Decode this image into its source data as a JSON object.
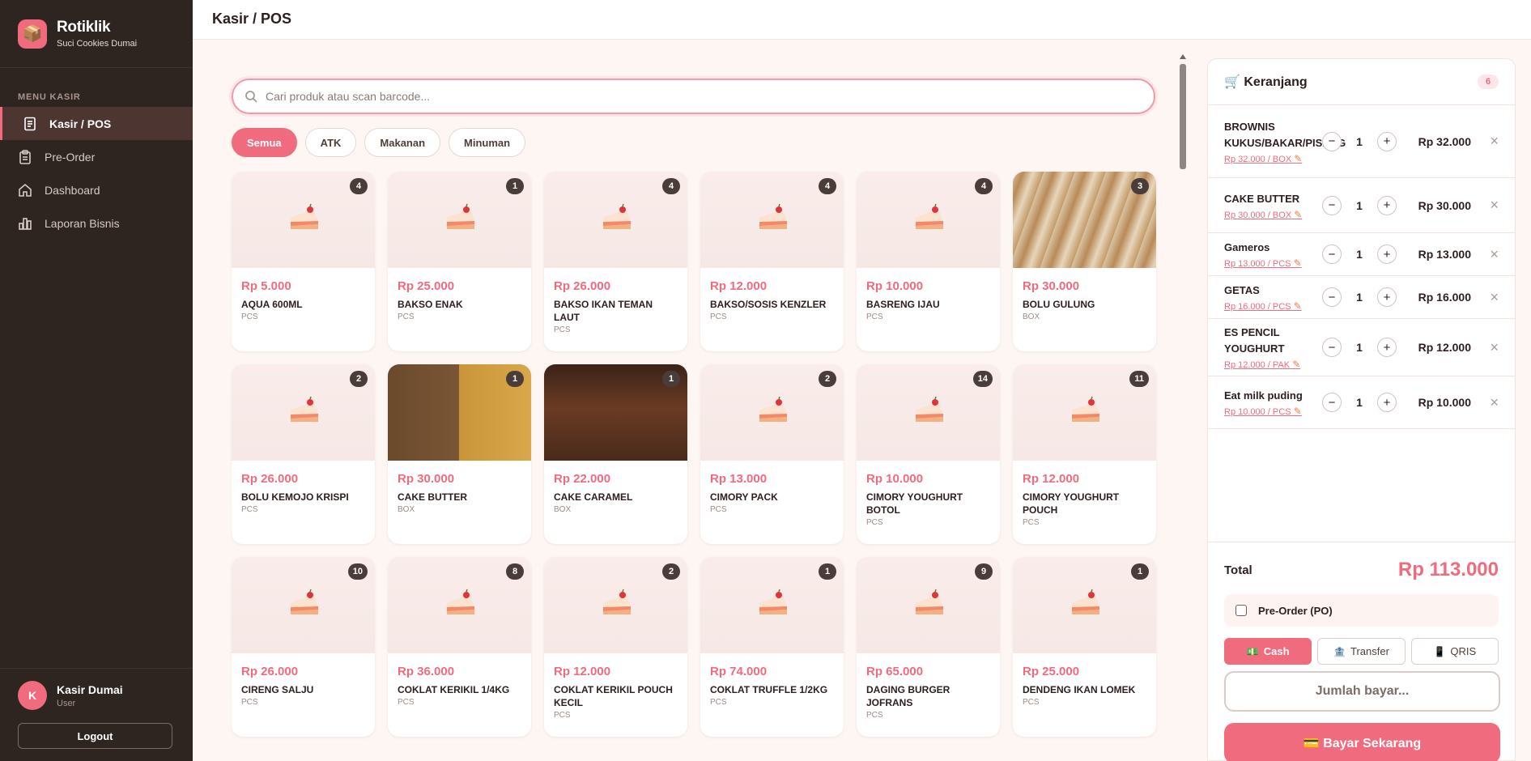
{
  "brand": {
    "name": "Rotiklik",
    "store": "Suci Cookies Dumai"
  },
  "sidebar": {
    "section_label": "MENU KASIR",
    "items": [
      {
        "label": "Kasir / POS",
        "icon": "receipt-icon",
        "active": true
      },
      {
        "label": "Pre-Order",
        "icon": "clipboard-icon",
        "active": false
      },
      {
        "label": "Dashboard",
        "icon": "home-icon",
        "active": false
      },
      {
        "label": "Laporan Bisnis",
        "icon": "bar-chart-icon",
        "active": false
      }
    ],
    "user": {
      "initial": "K",
      "name": "Kasir Dumai",
      "role": "User"
    },
    "logout_label": "Logout"
  },
  "header": {
    "title": "Kasir / POS"
  },
  "search": {
    "placeholder": "Cari produk atau scan barcode..."
  },
  "filters": [
    "Semua",
    "ATK",
    "Makanan",
    "Minuman"
  ],
  "active_filter": "Semua",
  "products": [
    {
      "price": "Rp 5.000",
      "name": "AQUA 600ML",
      "unit": "PCS",
      "stock": "4",
      "image": "cake"
    },
    {
      "price": "Rp 25.000",
      "name": "BAKSO ENAK",
      "unit": "PCS",
      "stock": "1",
      "image": "cake"
    },
    {
      "price": "Rp 26.000",
      "name": "BAKSO IKAN TEMAN LAUT",
      "unit": "PCS",
      "stock": "4",
      "image": "cake"
    },
    {
      "price": "Rp 12.000",
      "name": "BAKSO/SOSIS KENZLER",
      "unit": "PCS",
      "stock": "4",
      "image": "cake"
    },
    {
      "price": "Rp 10.000",
      "name": "BASRENG IJAU",
      "unit": "PCS",
      "stock": "4",
      "image": "cake"
    },
    {
      "price": "Rp 30.000",
      "name": "BOLU GULUNG",
      "unit": "BOX",
      "stock": "3",
      "image": "photo-roll"
    },
    {
      "price": "Rp 26.000",
      "name": "BOLU KEMOJO KRISPI",
      "unit": "PCS",
      "stock": "2",
      "image": "cake"
    },
    {
      "price": "Rp 30.000",
      "name": "CAKE BUTTER",
      "unit": "BOX",
      "stock": "1",
      "image": "photo-butter"
    },
    {
      "price": "Rp 22.000",
      "name": "CAKE CARAMEL",
      "unit": "BOX",
      "stock": "1",
      "image": "photo-caramel"
    },
    {
      "price": "Rp 13.000",
      "name": "CIMORY PACK",
      "unit": "PCS",
      "stock": "2",
      "image": "cake"
    },
    {
      "price": "Rp 10.000",
      "name": "CIMORY YOUGHURT BOTOL",
      "unit": "PCS",
      "stock": "14",
      "image": "cake"
    },
    {
      "price": "Rp 12.000",
      "name": "CIMORY YOUGHURT POUCH",
      "unit": "PCS",
      "stock": "11",
      "image": "cake"
    },
    {
      "price": "Rp 26.000",
      "name": "CIRENG SALJU",
      "unit": "PCS",
      "stock": "10",
      "image": "cake"
    },
    {
      "price": "Rp 36.000",
      "name": "COKLAT KERIKIL 1/4KG",
      "unit": "PCS",
      "stock": "8",
      "image": "cake"
    },
    {
      "price": "Rp 12.000",
      "name": "COKLAT KERIKIL POUCH KECIL",
      "unit": "PCS",
      "stock": "2",
      "image": "cake"
    },
    {
      "price": "Rp 74.000",
      "name": "COKLAT TRUFFLE 1/2KG",
      "unit": "PCS",
      "stock": "1",
      "image": "cake"
    },
    {
      "price": "Rp 65.000",
      "name": "DAGING BURGER JOFRANS",
      "unit": "PCS",
      "stock": "9",
      "image": "cake"
    },
    {
      "price": "Rp 25.000",
      "name": "DENDENG IKAN LOMEK",
      "unit": "PCS",
      "stock": "1",
      "image": "cake"
    }
  ],
  "cart": {
    "title": "🛒 Keranjang",
    "count": "6",
    "items": [
      {
        "name": "BROWNIS KUKUS/BAKAR/PISANG",
        "unit_price": "Rp 32.000 / BOX",
        "qty": "1",
        "total": "Rp 32.000"
      },
      {
        "name": "CAKE BUTTER",
        "unit_price": "Rp 30.000 / BOX",
        "qty": "1",
        "total": "Rp 30.000"
      },
      {
        "name": "Gameros",
        "unit_price": "Rp 13.000 / PCS",
        "qty": "1",
        "total": "Rp 13.000"
      },
      {
        "name": "GETAS",
        "unit_price": "Rp 16.000 / PCS",
        "qty": "1",
        "total": "Rp 16.000"
      },
      {
        "name": "ES PENCIL YOUGHURT",
        "unit_price": "Rp 12.000 / PAK",
        "qty": "1",
        "total": "Rp 12.000"
      },
      {
        "name": "Eat milk puding",
        "unit_price": "Rp 10.000 / PCS",
        "qty": "1",
        "total": "Rp 10.000"
      }
    ],
    "total_label": "Total",
    "total_value": "Rp 113.000",
    "preorder_label": "Pre-Order (PO)",
    "payment_methods": [
      {
        "label": "Cash",
        "icon": "💵",
        "active": true
      },
      {
        "label": "Transfer",
        "icon": "🏦",
        "active": false
      },
      {
        "label": "QRIS",
        "icon": "📱",
        "active": false
      }
    ],
    "amount_placeholder": "Jumlah bayar...",
    "pay_label": "💳 Bayar Sekarang"
  },
  "colors": {
    "accent": "#f06b7d",
    "sidebar": "#2e2420",
    "background": "#fdf6f3"
  }
}
